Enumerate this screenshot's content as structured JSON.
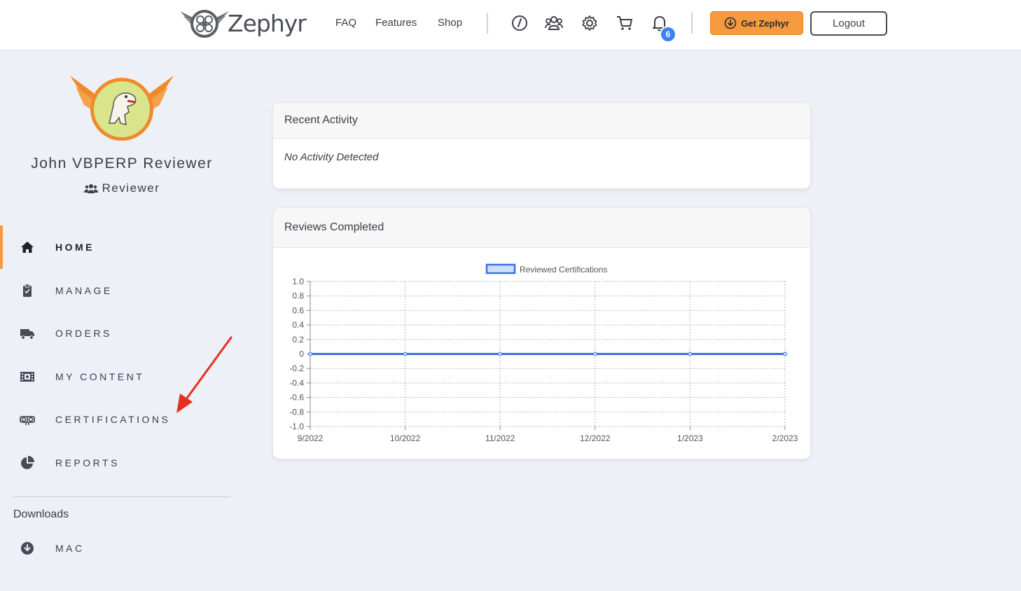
{
  "brand": {
    "name": "Zephyr"
  },
  "nav": {
    "faq": "FAQ",
    "features": "Features",
    "shop": "Shop"
  },
  "icons": [
    "speedometer-icon",
    "users-icon",
    "gear-icon",
    "cart-icon",
    "bell-icon"
  ],
  "notifications": {
    "count": "6"
  },
  "buttons": {
    "get_zephyr": "Get Zephyr",
    "logout": "Logout"
  },
  "colors": {
    "accent": "#f59a3e",
    "badge": "#3b82f6",
    "series": "#3b6fe0",
    "background": "#eef0f8"
  },
  "user": {
    "name": "John VBPERP Reviewer",
    "role": "Reviewer"
  },
  "sidebar": {
    "items": [
      {
        "label": "HOME",
        "icon": "home-icon",
        "active": true
      },
      {
        "label": "MANAGE",
        "icon": "clipboard-icon",
        "active": false
      },
      {
        "label": "ORDERS",
        "icon": "truck-icon",
        "active": false
      },
      {
        "label": "MY CONTENT",
        "icon": "film-icon",
        "active": false
      },
      {
        "label": "CERTIFICATIONS",
        "icon": "certificate-icon",
        "active": false
      },
      {
        "label": "REPORTS",
        "icon": "pie-chart-icon",
        "active": false
      }
    ],
    "downloads_heading": "Downloads",
    "downloads": [
      {
        "label": "MAC",
        "icon": "download-circle-icon"
      }
    ]
  },
  "recent_activity": {
    "title": "Recent Activity",
    "empty_text": "No Activity Detected"
  },
  "reviews": {
    "title": "Reviews Completed"
  },
  "chart_data": {
    "type": "line",
    "title": "",
    "xlabel": "",
    "ylabel": "",
    "x": [
      "9/2022",
      "10/2022",
      "11/2022",
      "12/2022",
      "1/2023",
      "2/2023"
    ],
    "series": [
      {
        "name": "Reviewed Certifications",
        "values": [
          0,
          0,
          0,
          0,
          0,
          0
        ]
      }
    ],
    "ylim": [
      -1.0,
      1.0
    ],
    "yticks": [
      "1.0",
      "0.8",
      "0.6",
      "0.4",
      "0.2",
      "0",
      "-0.2",
      "-0.4",
      "-0.6",
      "-0.8",
      "-1.0"
    ],
    "grid": true,
    "legend": "top-center"
  }
}
